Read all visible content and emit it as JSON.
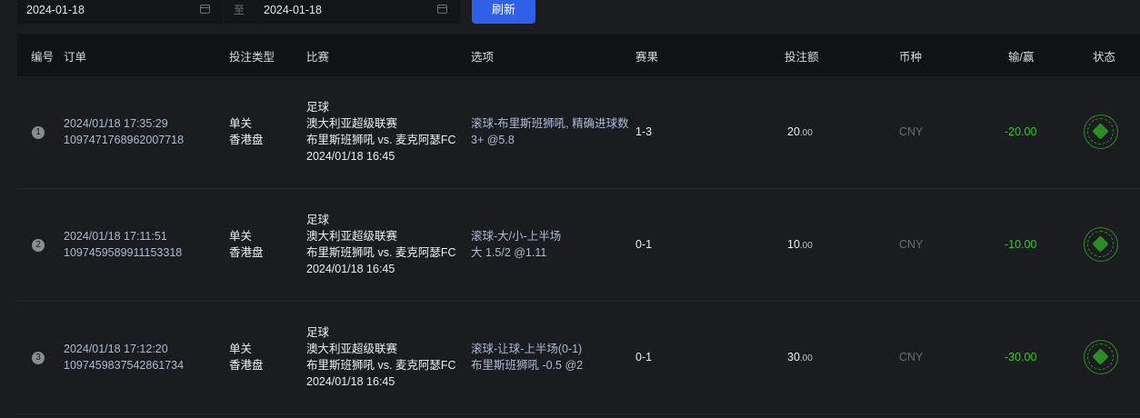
{
  "filters": {
    "start_date": "2024-01-18",
    "separator": "至",
    "end_date": "2024-01-18",
    "refresh_label": "刷新",
    "calendar_icon": "calendar-icon"
  },
  "table": {
    "headers": {
      "no": "编号",
      "order": "订单",
      "bet_type": "投注类型",
      "match": "比赛",
      "option": "选项",
      "result": "赛果",
      "amount": "投注额",
      "currency": "币种",
      "win_loss": "输/赢",
      "status": "状态"
    },
    "rows": [
      {
        "no": "1",
        "order_time": "2024/01/18 17:35:29",
        "order_id": "1097471768962007718",
        "bet_type": "单关",
        "odds_type": "香港盘",
        "sport": "足球",
        "league": "澳大利亚超级联赛",
        "teams": "布里斯班狮吼 vs. 麦克阿瑟FC",
        "match_time": "2024/01/18 16:45",
        "option_line1": "滚球-布里斯班狮吼, 精确进球数",
        "option_line2": "3+  @5.8",
        "result": "1-3",
        "amount_int": "20",
        "amount_dec": ".00",
        "currency": "CNY",
        "win_loss": "-20.00",
        "status_icon": "settled-stamp-icon"
      },
      {
        "no": "2",
        "order_time": "2024/01/18 17:11:51",
        "order_id": "1097459589911153318",
        "bet_type": "单关",
        "odds_type": "香港盘",
        "sport": "足球",
        "league": "澳大利亚超级联赛",
        "teams": "布里斯班狮吼 vs. 麦克阿瑟FC",
        "match_time": "2024/01/18 16:45",
        "option_line1": "滚球-大/小-上半场",
        "option_line2": "大 1.5/2  @1.11",
        "result": "0-1",
        "amount_int": "10",
        "amount_dec": ".00",
        "currency": "CNY",
        "win_loss": "-10.00",
        "status_icon": "settled-stamp-icon"
      },
      {
        "no": "3",
        "order_time": "2024/01/18 17:12:20",
        "order_id": "1097459837542861734",
        "bet_type": "单关",
        "odds_type": "香港盘",
        "sport": "足球",
        "league": "澳大利亚超级联赛",
        "teams": "布里斯班狮吼 vs. 麦克阿瑟FC",
        "match_time": "2024/01/18 16:45",
        "option_line1": "滚球-让球-上半场(0-1)",
        "option_line2": "布里斯班狮吼 -0.5  @2",
        "result": "0-1",
        "amount_int": "30",
        "amount_dec": ".00",
        "currency": "CNY",
        "win_loss": "-30.00",
        "status_icon": "settled-stamp-icon"
      }
    ]
  },
  "colors": {
    "accent": "#3160e8",
    "win_loss_text": "#38c62b",
    "background": "#1b1c1f"
  }
}
